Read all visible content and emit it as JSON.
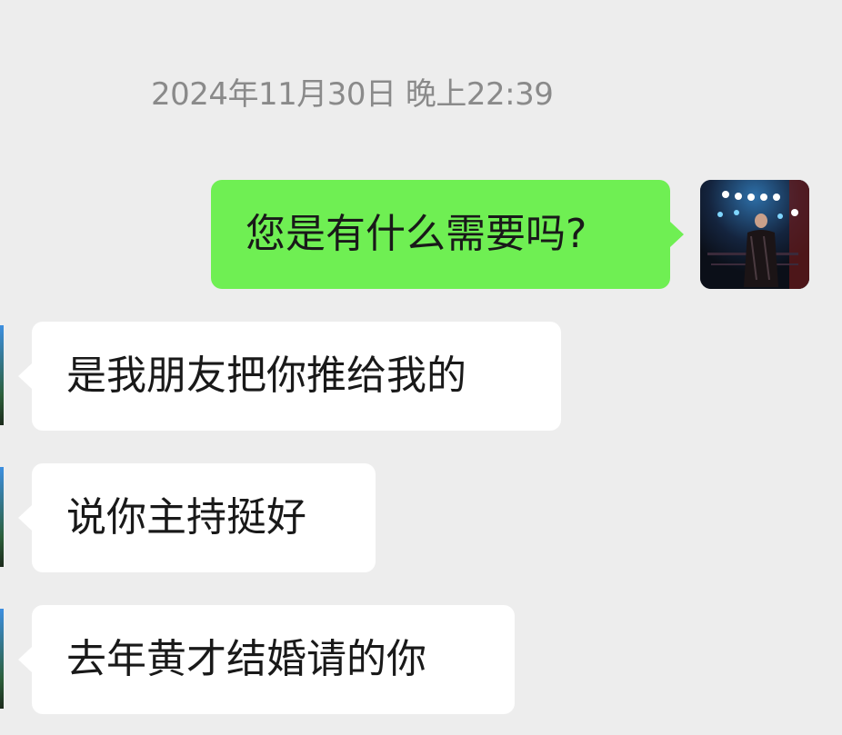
{
  "chat": {
    "timestamp": "2024年11月30日 晚上22:39",
    "messages": [
      {
        "direction": "outgoing",
        "text": "您是有什么需要吗?"
      },
      {
        "direction": "incoming",
        "text": "是我朋友把你推给我的"
      },
      {
        "direction": "incoming",
        "text": "说你主持挺好"
      },
      {
        "direction": "incoming",
        "text": "去年黄才结婚请的你"
      }
    ]
  },
  "colors": {
    "background": "#ededed",
    "outgoing_bubble": "#6fef53",
    "incoming_bubble": "#ffffff",
    "timestamp_text": "#8a8a8a",
    "message_text": "#191919"
  },
  "icons": {
    "self_avatar": "stage-performer-photo",
    "peer_avatar": "landscape-photo-cropped"
  }
}
